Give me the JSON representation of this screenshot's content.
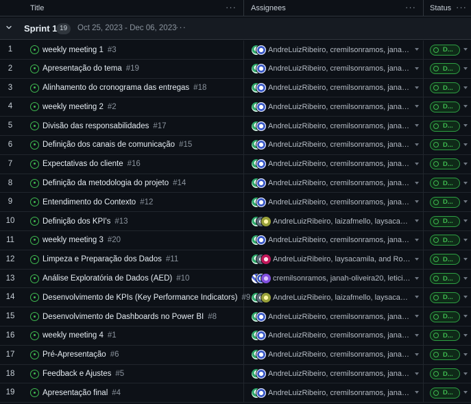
{
  "columns": {
    "title": "Title",
    "assignees": "Assignees",
    "status": "Status",
    "menu": "···"
  },
  "group": {
    "name": "Sprint 1",
    "count": "19",
    "dates": "Oct 25, 2023 - Dec 06, 2023",
    "menu": "···"
  },
  "status_label": "D...",
  "rows": [
    {
      "n": "1",
      "title": "weekly meeting 1",
      "issue": "#3",
      "assignees": "AndreLuizRibeiro, cremilsonramos, janah-o...",
      "avatars": [
        "a1",
        "a2"
      ]
    },
    {
      "n": "2",
      "title": "Apresentação do tema",
      "issue": "#19",
      "assignees": "AndreLuizRibeiro, cremilsonramos, janah-o...",
      "avatars": [
        "a1",
        "a2"
      ]
    },
    {
      "n": "3",
      "title": "Alinhamento do cronograma das entregas",
      "issue": "#18",
      "assignees": "AndreLuizRibeiro, cremilsonramos, janah-o...",
      "avatars": [
        "a1",
        "a2"
      ]
    },
    {
      "n": "4",
      "title": "weekly meeting 2",
      "issue": "#2",
      "assignees": "AndreLuizRibeiro, cremilsonramos, janah-o...",
      "avatars": [
        "a1",
        "a2"
      ]
    },
    {
      "n": "5",
      "title": "Divisão das responsabilidades",
      "issue": "#17",
      "assignees": "AndreLuizRibeiro, cremilsonramos, janah-o...",
      "avatars": [
        "a1",
        "a2"
      ]
    },
    {
      "n": "6",
      "title": "Definição dos canais de comunicação",
      "issue": "#15",
      "assignees": "AndreLuizRibeiro, cremilsonramos, janah-o...",
      "avatars": [
        "a1",
        "a2"
      ]
    },
    {
      "n": "7",
      "title": "Expectativas do cliente",
      "issue": "#16",
      "assignees": "AndreLuizRibeiro, cremilsonramos, janah-o...",
      "avatars": [
        "a1",
        "a2"
      ]
    },
    {
      "n": "8",
      "title": "Definição da metodologia do projeto",
      "issue": "#14",
      "assignees": "AndreLuizRibeiro, cremilsonramos, janah-o...",
      "avatars": [
        "a1",
        "a2"
      ]
    },
    {
      "n": "9",
      "title": "Entendimento do Contexto",
      "issue": "#12",
      "assignees": "AndreLuizRibeiro, cremilsonramos, janah-o...",
      "avatars": [
        "a1",
        "a2"
      ]
    },
    {
      "n": "10",
      "title": "Definição dos KPI's",
      "issue": "#13",
      "assignees": "AndreLuizRibeiro, laizafmello, laysacamila, ...",
      "avatars": [
        "a1",
        "a3",
        "a4"
      ]
    },
    {
      "n": "11",
      "title": "weekly meeting 3",
      "issue": "#20",
      "assignees": "AndreLuizRibeiro, cremilsonramos, janah-o...",
      "avatars": [
        "a1",
        "a2"
      ]
    },
    {
      "n": "12",
      "title": "Limpeza e Preparação dos Dados",
      "issue": "#11",
      "assignees": "AndreLuizRibeiro, laysacamila, and Rosinunes",
      "avatars": [
        "a1",
        "a3",
        "a5"
      ]
    },
    {
      "n": "13",
      "title": "Análise Exploratória de Dados (AED)",
      "issue": "#10",
      "assignees": "cremilsonramos, janah-oliveira20, leticiame...",
      "avatars": [
        "a6",
        "a2",
        "a7"
      ]
    },
    {
      "n": "14",
      "title": "Desenvolvimento de KPIs (Key Performance Indicators)",
      "issue": "#9",
      "assignees": "AndreLuizRibeiro, laizafmello, laysacamila, ...",
      "avatars": [
        "a1",
        "a3",
        "a4"
      ]
    },
    {
      "n": "15",
      "title": "Desenvolvimento de Dashboards no Power BI",
      "issue": "#8",
      "assignees": "AndreLuizRibeiro, cremilsonramos, janah-o...",
      "avatars": [
        "a1",
        "a2"
      ]
    },
    {
      "n": "16",
      "title": "weekly meeting 4",
      "issue": "#1",
      "assignees": "AndreLuizRibeiro, cremilsonramos, janah-o...",
      "avatars": [
        "a1",
        "a2"
      ]
    },
    {
      "n": "17",
      "title": "Pré-Apresentação",
      "issue": "#6",
      "assignees": "AndreLuizRibeiro, cremilsonramos, janah-o...",
      "avatars": [
        "a1",
        "a2"
      ]
    },
    {
      "n": "18",
      "title": "Feedback e Ajustes",
      "issue": "#5",
      "assignees": "AndreLuizRibeiro, cremilsonramos, janah-o...",
      "avatars": [
        "a1",
        "a2"
      ]
    },
    {
      "n": "19",
      "title": "Apresentação final",
      "issue": "#4",
      "assignees": "AndreLuizRibeiro, cremilsonramos, janah-o...",
      "avatars": [
        "a1",
        "a2"
      ]
    }
  ]
}
